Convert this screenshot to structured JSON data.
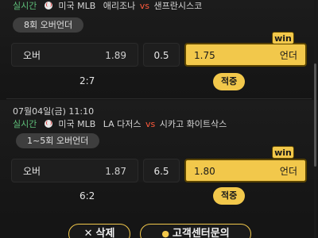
{
  "games": [
    {
      "datetime": "",
      "status": "실시간",
      "league": "미국 MLB",
      "home": "애리조나",
      "vs": "vs",
      "away": "샌프란시스코",
      "market": "8회 오버언더",
      "over_label": "오버",
      "over_odds": "1.89",
      "line": "0.5",
      "under_odds": "1.75",
      "under_label": "언더",
      "win_badge": "win",
      "score": "2:7",
      "hit_label": "적중"
    },
    {
      "datetime": "07월04일(금) 11:10",
      "status": "실시간",
      "league": "미국 MLB",
      "home": "LA 다저스",
      "vs": "vs",
      "away": "시카고 화이트삭스",
      "market": "1~5회 오버언더",
      "over_label": "오버",
      "over_odds": "1.87",
      "line": "6.5",
      "under_odds": "1.80",
      "under_label": "언더",
      "win_badge": "win",
      "score": "6:2",
      "hit_label": "적중"
    }
  ],
  "actions": {
    "delete_label": "삭제",
    "support_label": "고객센터문의"
  },
  "colors": {
    "accent": "#f2c84b",
    "live": "#5fbf7a",
    "vs": "#ff5a3c",
    "background": "#151515"
  }
}
